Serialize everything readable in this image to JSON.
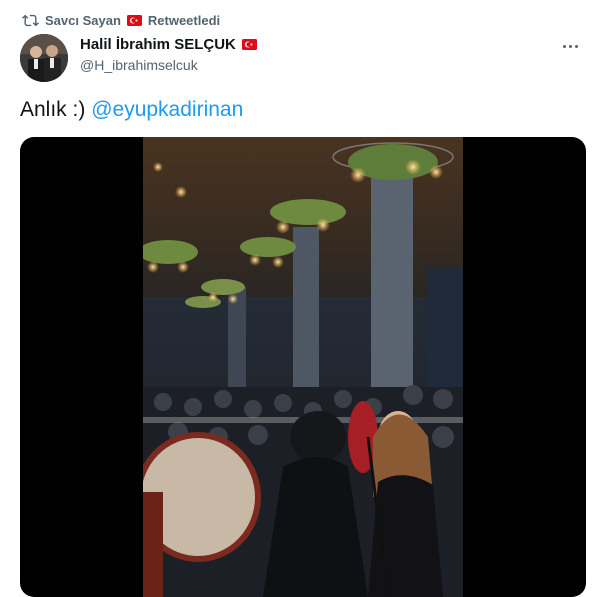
{
  "retweet": {
    "icon": "retweet-icon",
    "user": "Savcı Sayan",
    "label": "Retweetledi",
    "flag": "turkey-flag-icon"
  },
  "author": {
    "name": "Halil İbrahim SELÇUK",
    "handle": "@H_ibrahimselcuk",
    "avatar": "avatar-photo",
    "flag": "turkey-flag-icon"
  },
  "tweet": {
    "text": "Anlık :)",
    "mention": "@eyupkadirinan"
  },
  "colors": {
    "link": "#1d9bf0",
    "secondary_text": "#536471",
    "flag_red": "#e30a17"
  }
}
